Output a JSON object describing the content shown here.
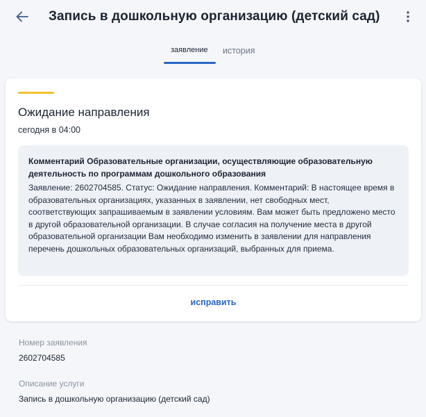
{
  "header": {
    "title": "Запись в дошкольную организацию (детский сад)",
    "back_icon": "arrow-left-icon",
    "more_icon": "more-vertical-icon"
  },
  "tabs": [
    {
      "label": "заявление",
      "active": true
    },
    {
      "label": "история",
      "active": false
    }
  ],
  "status": {
    "title": "Ожидание направления",
    "time": "сегодня в 04:00",
    "accent_color": "#f2c230"
  },
  "comment": {
    "heading": "Комментарий Образовательные организации, осуществляющие образовательную деятельность по программам дошкольного образования",
    "text": "Заявление: 2602704585. Статус: Ожидание направления. Комментарий: В настоящее время в образовательных организациях, указанных в заявлении, нет свободных мест, соответствующих запрашиваемым в заявлении условиям. Вам может быть предложено место в другой образовательной организации. В случае согласия на получение места в другой образовательной организации Вам необходимо изменить в заявлении для направления перечень дошкольных образовательных организаций, выбранных для приема."
  },
  "actions": {
    "fix_label": "исправить"
  },
  "details": {
    "number_label": "Номер заявления",
    "number_value": "2602704585",
    "service_label": "Описание услуги",
    "service_value": "Запись в дошкольную организацию (детский сад)"
  },
  "colors": {
    "accent": "#2a66c4",
    "background": "#f4f6f9"
  }
}
